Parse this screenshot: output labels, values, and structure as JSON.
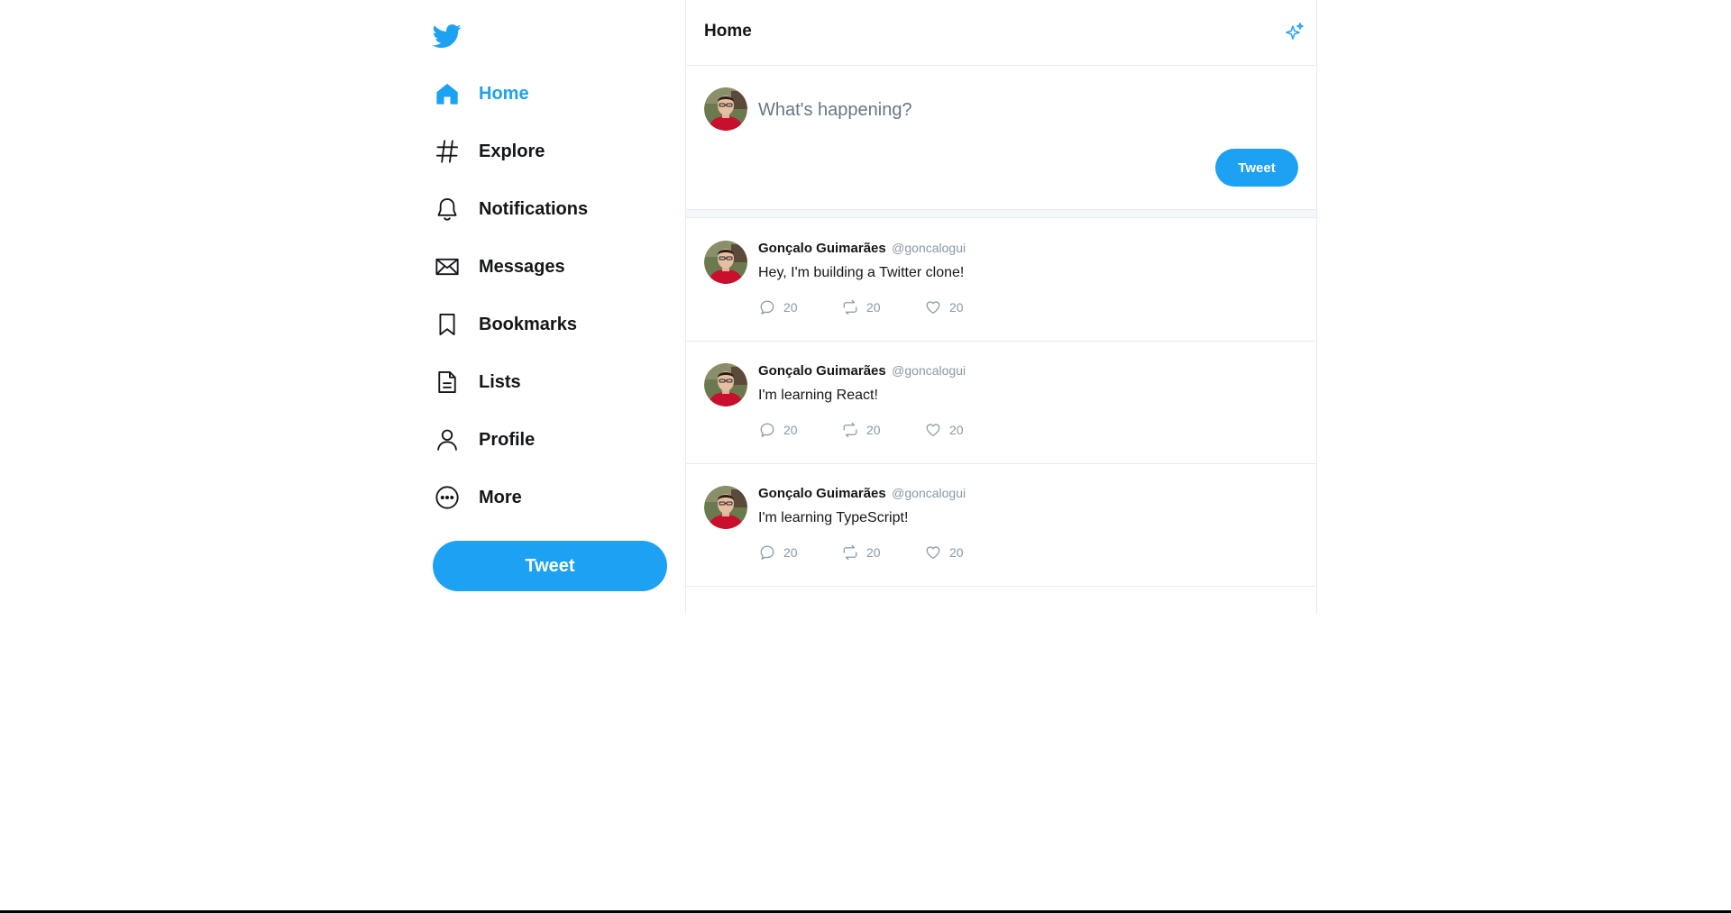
{
  "colors": {
    "accent": "#1da1f2",
    "text": "#14171a",
    "muted": "#8899a6",
    "border": "#e6ecf0"
  },
  "sidebar": {
    "logo_icon": "twitter-bird-icon",
    "items": [
      {
        "label": "Home",
        "icon": "home-icon",
        "active": true
      },
      {
        "label": "Explore",
        "icon": "hashtag-icon",
        "active": false
      },
      {
        "label": "Notifications",
        "icon": "bell-icon",
        "active": false
      },
      {
        "label": "Messages",
        "icon": "envelope-icon",
        "active": false
      },
      {
        "label": "Bookmarks",
        "icon": "bookmark-icon",
        "active": false
      },
      {
        "label": "Lists",
        "icon": "document-icon",
        "active": false
      },
      {
        "label": "Profile",
        "icon": "person-icon",
        "active": false
      },
      {
        "label": "More",
        "icon": "more-circle-icon",
        "active": false
      }
    ],
    "tweet_button": "Tweet"
  },
  "header": {
    "title": "Home",
    "sparkle_icon": "sparkle-icon"
  },
  "composer": {
    "placeholder": "What's happening?",
    "value": "",
    "tweet_button": "Tweet"
  },
  "tweets": [
    {
      "name": "Gonçalo Guimarães",
      "handle": "@goncalogui",
      "text": "Hey, I'm building a Twitter clone!",
      "replies": "20",
      "retweets": "20",
      "likes": "20"
    },
    {
      "name": "Gonçalo Guimarães",
      "handle": "@goncalogui",
      "text": "I'm learning React!",
      "replies": "20",
      "retweets": "20",
      "likes": "20"
    },
    {
      "name": "Gonçalo Guimarães",
      "handle": "@goncalogui",
      "text": "I'm learning TypeScript!",
      "replies": "20",
      "retweets": "20",
      "likes": "20"
    }
  ]
}
